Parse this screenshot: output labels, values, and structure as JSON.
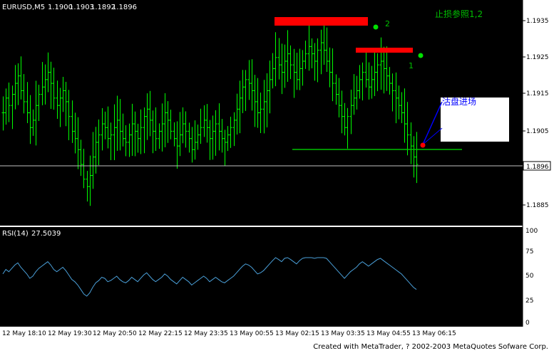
{
  "symbol_header": "EURUSD,M5",
  "ohlc": [
    "1.1900",
    "1.1903",
    "1.1892",
    "1.1896"
  ],
  "price_axis": {
    "ticks": [
      "1.1935",
      "1.1925",
      "1.1915",
      "1.1905",
      "1.1885"
    ],
    "current_price": "1.1896"
  },
  "annotations": {
    "stop_loss_note": "止损参照1,2",
    "marker_2": "2",
    "marker_1": "1",
    "entry_note": "沽盘进场"
  },
  "rsi": {
    "label": "RSI(14)",
    "value": "27.5039",
    "levels": [
      "100",
      "75",
      "50",
      "25",
      "0"
    ]
  },
  "time_axis": [
    "12 May 18:10",
    "12 May 19:30",
    "12 May 20:50",
    "12 May 22:15",
    "12 May 23:35",
    "13 May 00:55",
    "13 May 02:15",
    "13 May 03:35",
    "13 May 04:55",
    "13 May 06:15"
  ],
  "footer": "Created with MetaTrader, ? 2002-2003 MetaQuotes Sofware Corp.",
  "colors": {
    "background": "#000000",
    "bars": "#00ff00",
    "rsi_line": "#4a9fd8",
    "resistance": "#ff0000",
    "support": "#00c000",
    "marker": "#00e000",
    "entry_dot": "#ff0000",
    "entry_line": "#0000ff"
  },
  "chart_data": {
    "type": "candlestick",
    "series_name": "EURUSD,M5",
    "close": [
      1.191,
      1.1914,
      1.1912,
      1.1915,
      1.1918,
      1.192,
      1.1916,
      1.1913,
      1.191,
      1.1906,
      1.1908,
      1.1912,
      1.1915,
      1.1917,
      1.1919,
      1.1921,
      1.1918,
      1.1914,
      1.1912,
      1.1914,
      1.1916,
      1.1913,
      1.1909,
      1.1905,
      1.1903,
      1.19,
      1.1896,
      1.1892,
      1.189,
      1.1893,
      1.1898,
      1.1902,
      1.1904,
      1.1907,
      1.1906,
      1.1903,
      1.1904,
      1.1906,
      1.1908,
      1.1905,
      1.1903,
      1.1902,
      1.1904,
      1.1907,
      1.1905,
      1.1903,
      1.1906,
      1.1909,
      1.1911,
      1.1908,
      1.1905,
      1.1903,
      1.1905,
      1.1907,
      1.191,
      1.1908,
      1.1905,
      1.1903,
      1.1901,
      1.1904,
      1.1907,
      1.1905,
      1.1903,
      1.19,
      1.1902,
      1.1904,
      1.1906,
      1.1908,
      1.1906,
      1.1903,
      1.1905,
      1.1907,
      1.1905,
      1.1903,
      1.1902,
      1.1904,
      1.1906,
      1.1908,
      1.1911,
      1.1914,
      1.1917,
      1.1919,
      1.1918,
      1.1916,
      1.1913,
      1.191,
      1.1911,
      1.1913,
      1.1916,
      1.1919,
      1.1922,
      1.1925,
      1.1923,
      1.1921,
      1.1924,
      1.1926,
      1.1923,
      1.1921,
      1.1919,
      1.1922,
      1.1924,
      1.1926,
      1.1928,
      1.1926,
      1.1924,
      1.1927,
      1.1929,
      1.1927,
      1.1924,
      1.1921,
      1.1918,
      1.1915,
      1.1912,
      1.1909,
      1.1906,
      1.1909,
      1.1912,
      1.1914,
      1.1916,
      1.1919,
      1.1921,
      1.1919,
      1.1917,
      1.1919,
      1.1921,
      1.1923,
      1.1924,
      1.1922,
      1.192,
      1.1918,
      1.1916,
      1.1914,
      1.1912,
      1.191,
      1.1907,
      1.1904,
      1.1901,
      1.1898,
      1.1896
    ]
  }
}
